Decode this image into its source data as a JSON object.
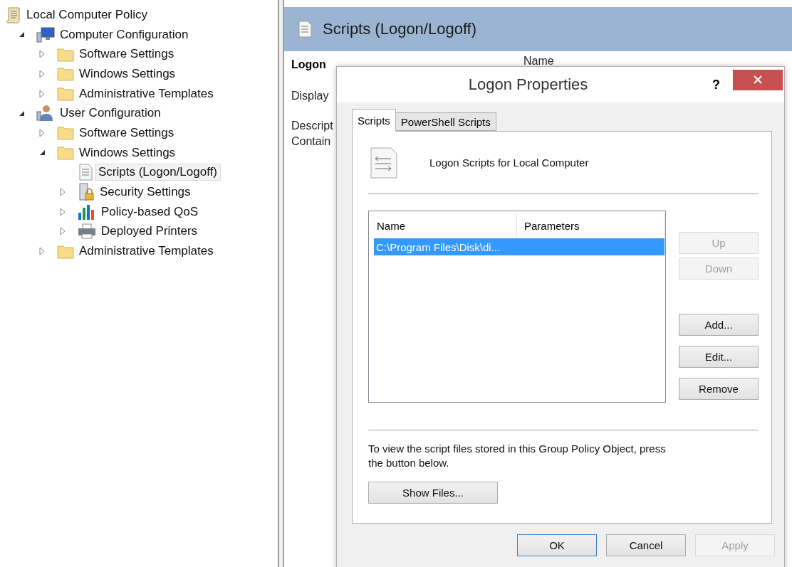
{
  "tree": {
    "items": [
      {
        "label": "Local Computer Policy",
        "kind": "policy",
        "selected": false,
        "children": [
          {
            "label": "Computer Configuration",
            "kind": "computer",
            "expanded": true,
            "selected": false,
            "children": [
              {
                "label": "Software Settings",
                "kind": "folder",
                "expanded": false,
                "selected": false
              },
              {
                "label": "Windows Settings",
                "kind": "folder",
                "expanded": false,
                "selected": false
              },
              {
                "label": "Administrative Templates",
                "kind": "folder",
                "expanded": false,
                "selected": false
              }
            ]
          },
          {
            "label": "User Configuration",
            "kind": "user",
            "expanded": true,
            "selected": false,
            "children": [
              {
                "label": "Software Settings",
                "kind": "folder",
                "expanded": false,
                "selected": false
              },
              {
                "label": "Windows Settings",
                "kind": "folder",
                "expanded": true,
                "selected": false,
                "children": [
                  {
                    "label": "Scripts (Logon/Logoff)",
                    "kind": "script",
                    "selected": true
                  },
                  {
                    "label": "Security Settings",
                    "kind": "security",
                    "expanded": false,
                    "selected": false
                  },
                  {
                    "label": "Policy-based QoS",
                    "kind": "qos",
                    "expanded": false,
                    "selected": false
                  },
                  {
                    "label": "Deployed Printers",
                    "kind": "printer",
                    "expanded": false,
                    "selected": false
                  }
                ]
              },
              {
                "label": "Administrative Templates",
                "kind": "folder",
                "expanded": false,
                "selected": false
              }
            ]
          }
        ]
      }
    ]
  },
  "details": {
    "title": "Scripts (Logon/Logoff)",
    "section": "Logon",
    "fields": [
      "Display",
      "Descript",
      "Contain"
    ],
    "column_1": "Name"
  },
  "dialog": {
    "title": "Logon Properties",
    "help": "?",
    "tabs": [
      {
        "label": "Scripts",
        "selected": true
      },
      {
        "label": "PowerShell Scripts",
        "selected": false
      }
    ],
    "heading": "Logon Scripts for Local Computer",
    "list": {
      "columns": [
        "Name",
        "Parameters"
      ],
      "rows": [
        {
          "name": "C:\\Program Files\\Disk\\di...",
          "selected": true
        }
      ]
    },
    "side_buttons": [
      {
        "label": "Up",
        "kind": "order",
        "disabled": true
      },
      {
        "label": "Down",
        "kind": "order",
        "disabled": true
      },
      {
        "label": "Add...",
        "kind": "edit",
        "disabled": false
      },
      {
        "label": "Edit...",
        "kind": "edit",
        "disabled": false
      },
      {
        "label": "Remove",
        "kind": "edit",
        "disabled": false
      }
    ],
    "note": "To view the script files stored in this Group Policy Object, press the button below.",
    "show_files": "Show Files...",
    "buttons": [
      {
        "label": "OK",
        "default": true,
        "disabled": false
      },
      {
        "label": "Cancel",
        "default": false,
        "disabled": false
      },
      {
        "label": "Apply",
        "default": false,
        "disabled": true
      }
    ]
  }
}
